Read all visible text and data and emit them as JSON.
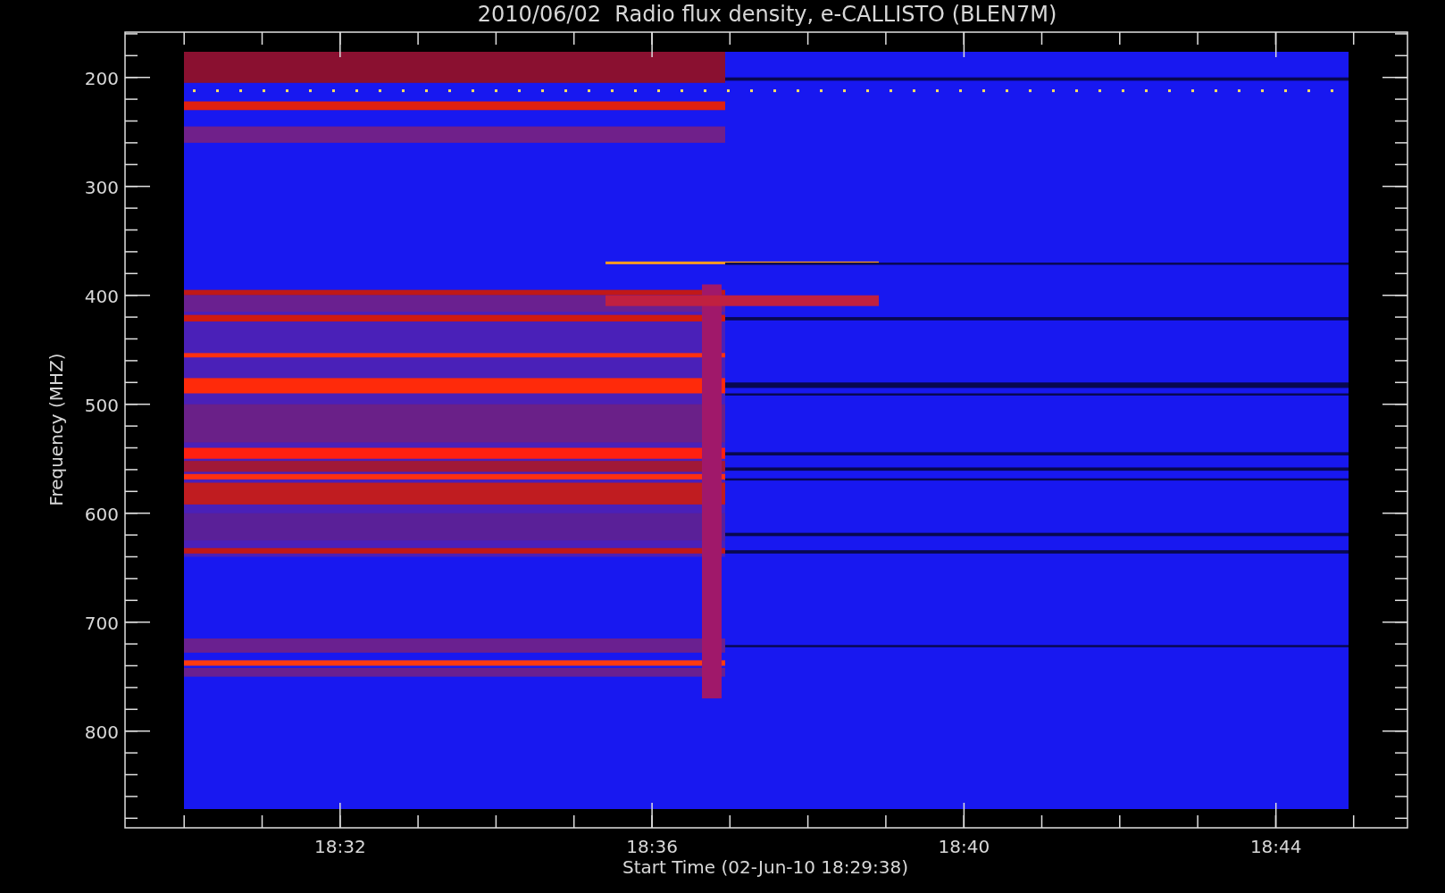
{
  "title": "2010/06/02  Radio flux density, e-CALLISTO (BLEN7M)",
  "y_axis": {
    "label": "Frequency (MHZ)",
    "ticks": [
      "200",
      "300",
      "400",
      "500",
      "600",
      "700",
      "800"
    ]
  },
  "x_axis": {
    "label": "Start Time (02-Jun-10 18:29:38)",
    "ticks": [
      "18:32",
      "18:36",
      "18:40",
      "18:44"
    ]
  }
}
